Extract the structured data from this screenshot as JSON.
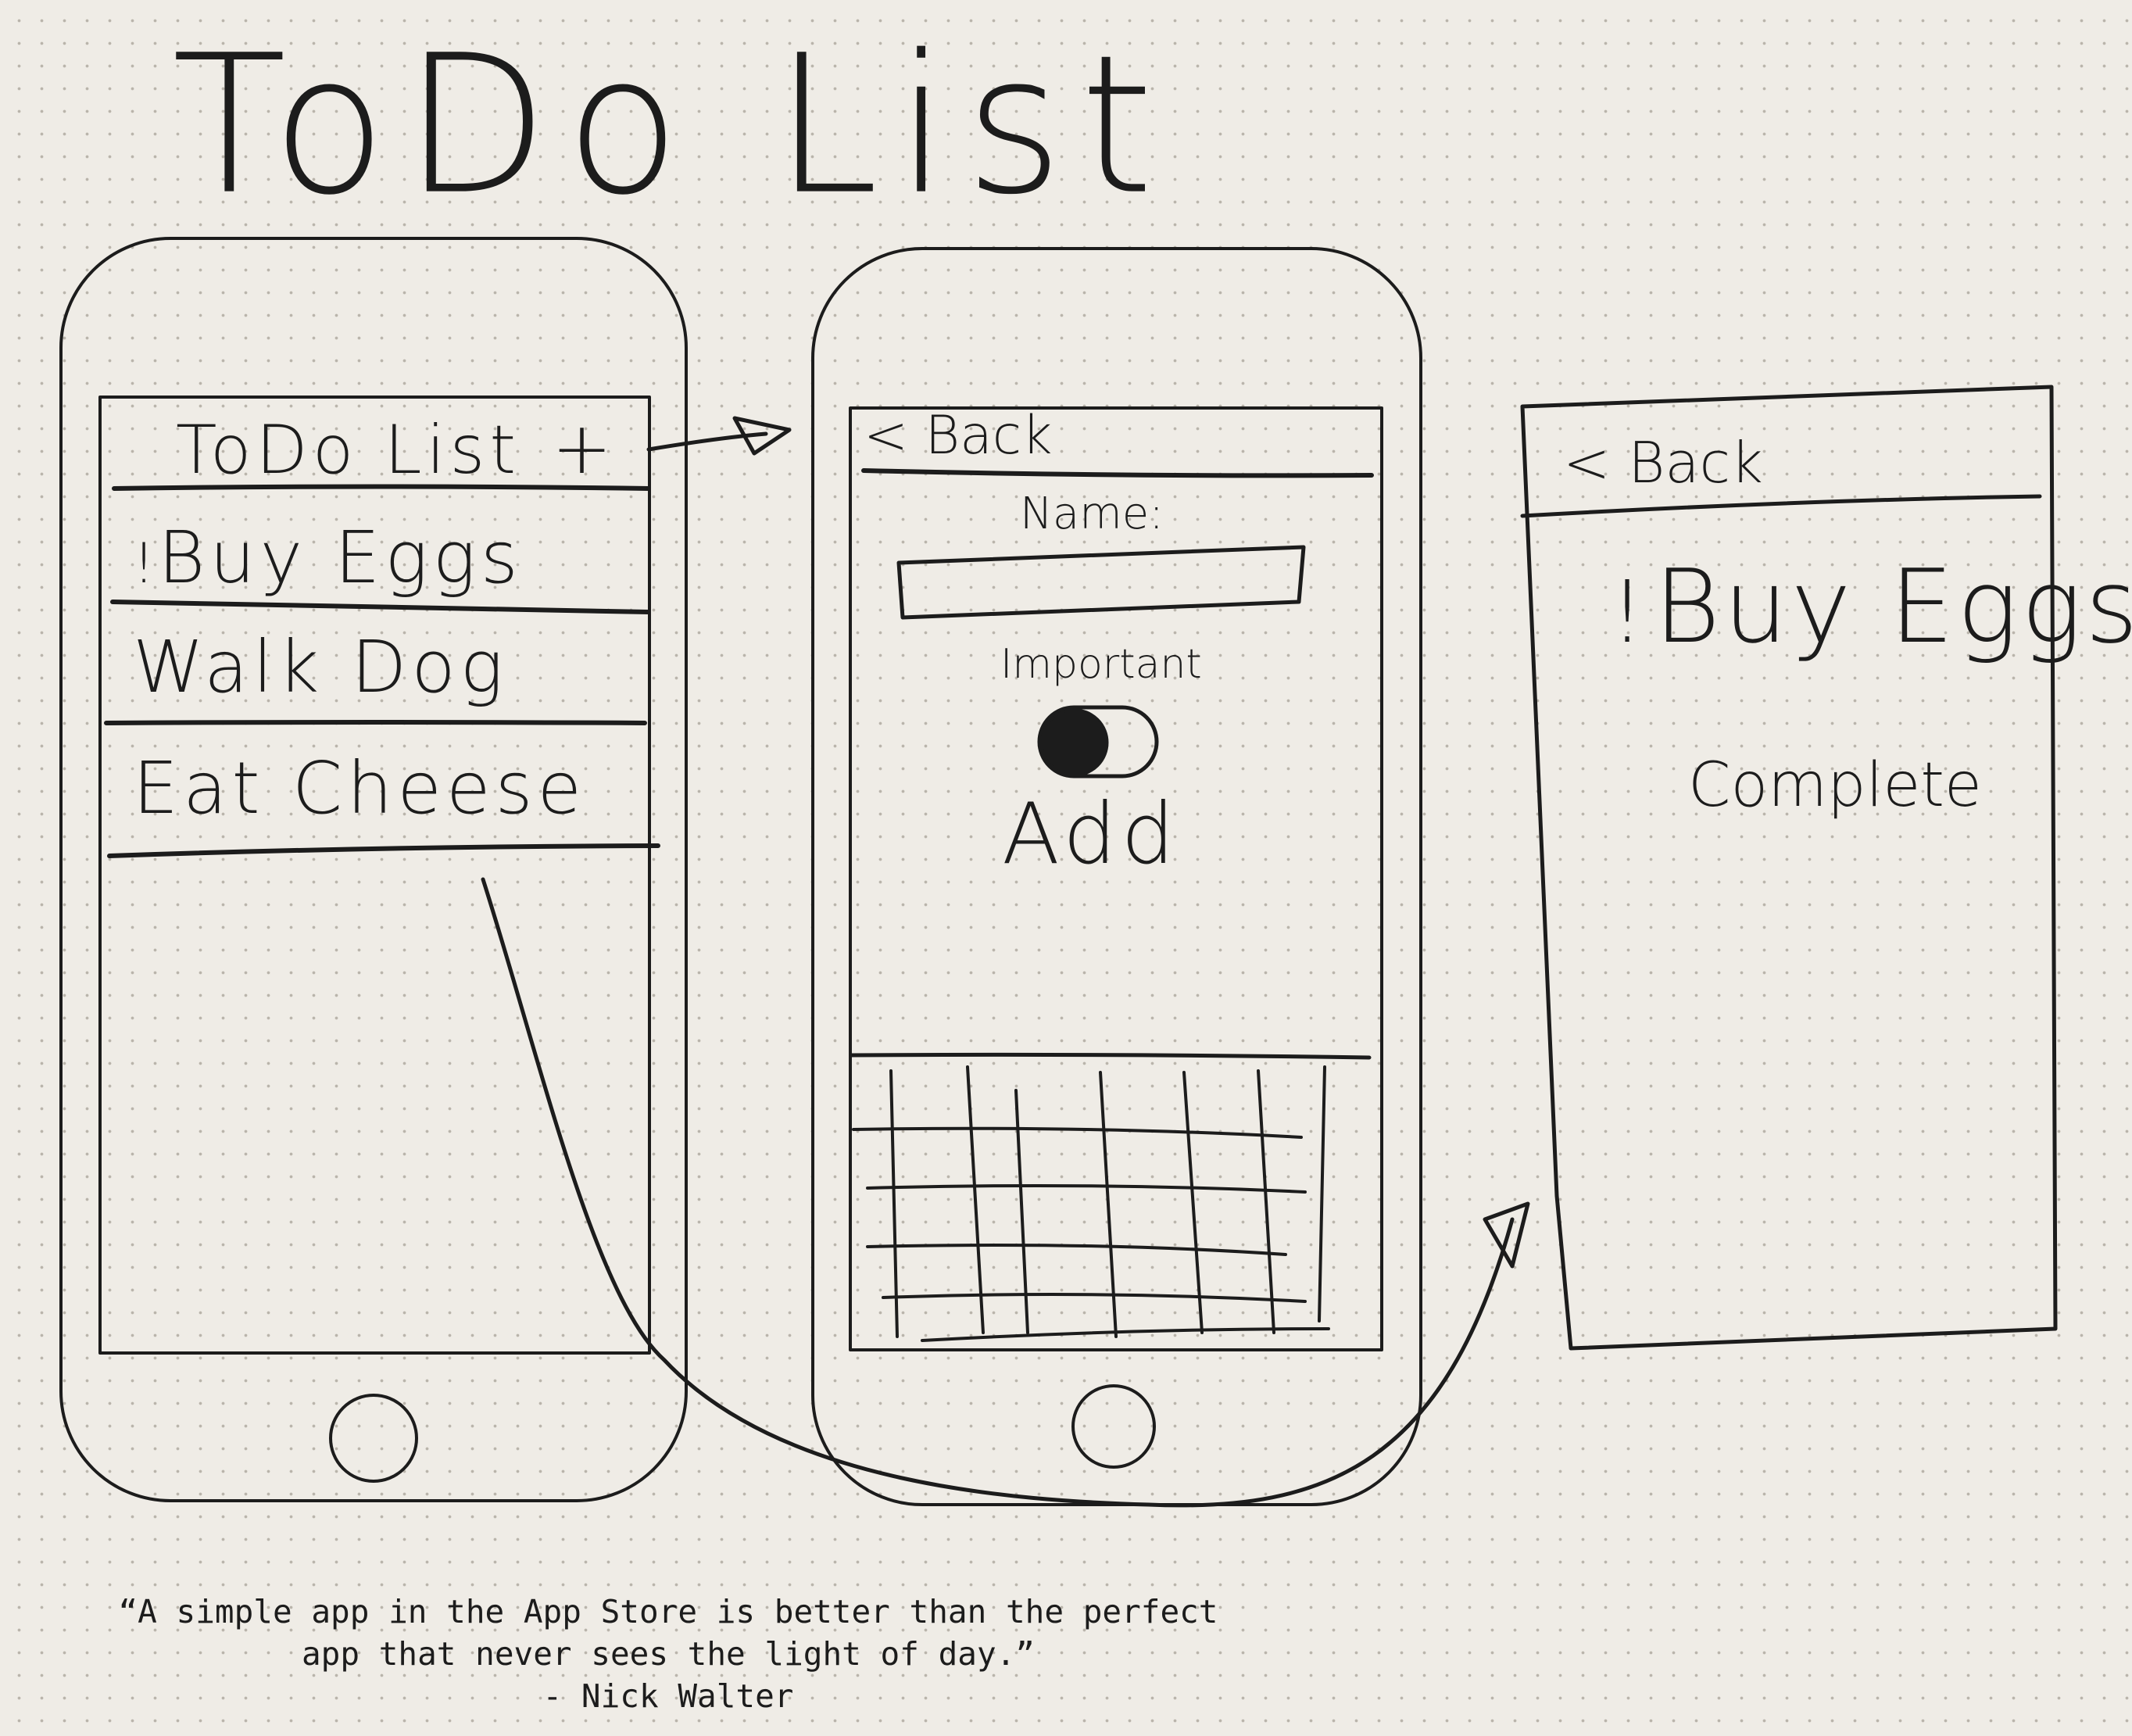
{
  "title": "ToDo List",
  "screens": {
    "list": {
      "nav_title": "ToDo List",
      "add_icon_label": "+",
      "items": [
        {
          "label": "Buy Eggs",
          "marker": "!"
        },
        {
          "label": "Walk Dog",
          "marker": ""
        },
        {
          "label": "Eat Cheese",
          "marker": ""
        }
      ]
    },
    "add": {
      "back_label": "< Back",
      "name_label": "Name:",
      "important_label": "Important",
      "add_label": "Add"
    },
    "detail": {
      "back_label": "< Back",
      "item_marker": "!",
      "item_label": "Buy Eggs",
      "complete_label": "Complete"
    }
  },
  "quote": {
    "line1": "“A simple app in the App Store is better than the perfect",
    "line2": "app that never sees the light of day.”",
    "author": "- Nick Walter"
  },
  "colors": {
    "ink": "#1c1c1c",
    "paper": "#efece6",
    "grid_dot": "#b9b4ab"
  },
  "icons": [
    "plus-icon",
    "toggle-switch-icon",
    "home-button-icon",
    "keyboard-icon",
    "arrow-icon"
  ]
}
